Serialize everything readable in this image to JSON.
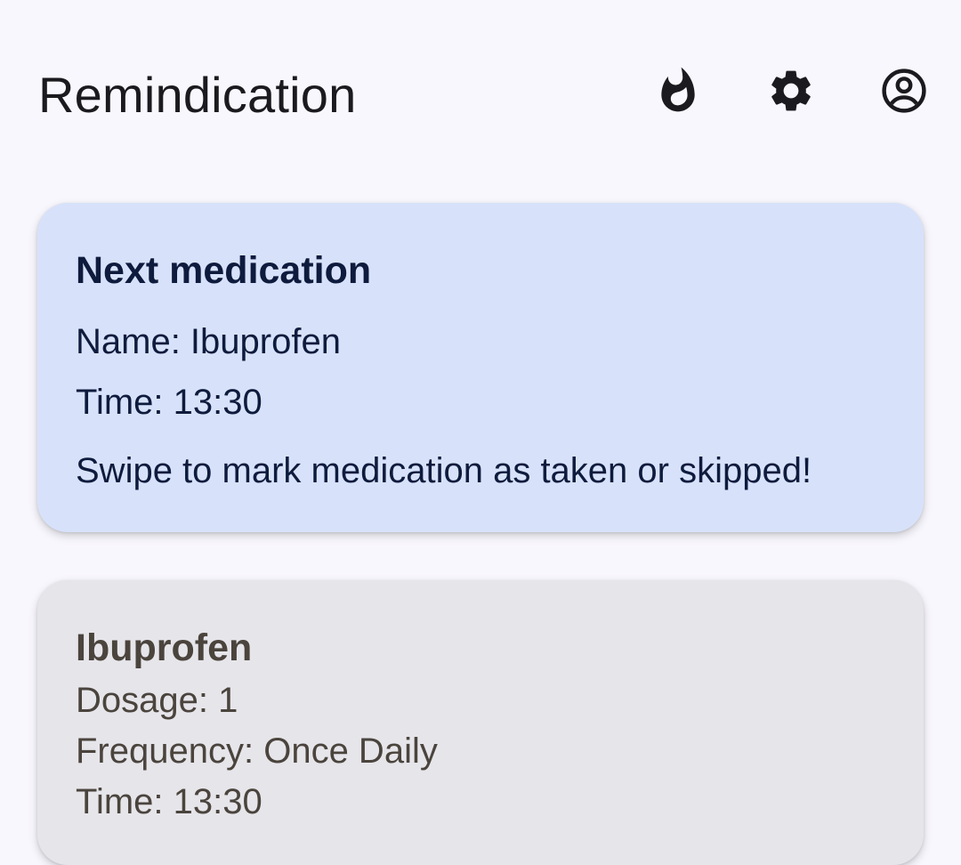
{
  "app": {
    "title": "Remindication"
  },
  "toolbar": {
    "streak_icon": "fire-icon",
    "settings_icon": "gear-icon",
    "account_icon": "account-circle-icon"
  },
  "next_medication": {
    "heading": "Next medication",
    "name": "Name: Ibuprofen",
    "time": "Time: 13:30",
    "hint": "Swipe to mark medication as taken or skipped!"
  },
  "medications": [
    {
      "name": "Ibuprofen",
      "dosage": "Dosage: 1",
      "frequency": "Frequency: Once Daily",
      "time": "Time: 13:30"
    }
  ],
  "colors": {
    "background": "#f8f7fd",
    "next_card_bg": "#d7e2fa",
    "next_card_text": "#0f1b3d",
    "med_card_bg": "#e6e5ea",
    "med_card_text": "#4a443d",
    "icon": "#1b1b1f"
  }
}
